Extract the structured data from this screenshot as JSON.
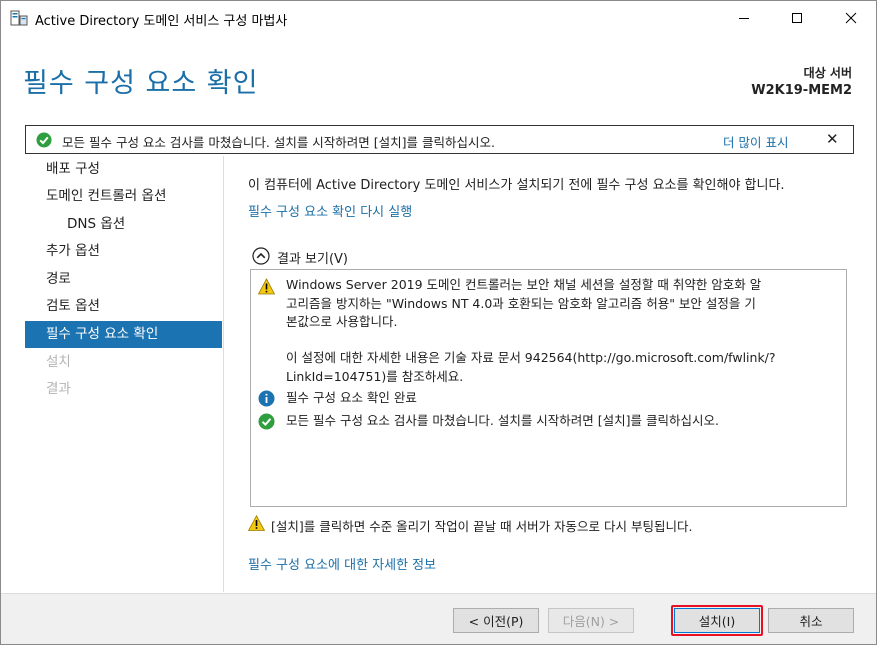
{
  "window": {
    "title": "Active Directory 도메인 서비스 구성 마법사"
  },
  "header": {
    "page_title": "필수 구성 요소 확인",
    "target_label": "대상 서버",
    "target_name": "W2K19-MEM2"
  },
  "notification": {
    "text": "모든 필수 구성 요소 검사를 마쳤습니다. 설치를 시작하려면 [설치]를 클릭하십시오.",
    "more_label": "더 많이 표시",
    "close_label": "✕"
  },
  "nav": {
    "items": [
      {
        "label": "배포 구성",
        "state": "normal"
      },
      {
        "label": "도메인 컨트롤러 옵션",
        "state": "normal"
      },
      {
        "label": "DNS 옵션",
        "state": "normal"
      },
      {
        "label": "추가 옵션",
        "state": "normal"
      },
      {
        "label": "경로",
        "state": "normal"
      },
      {
        "label": "검토 옵션",
        "state": "normal"
      },
      {
        "label": "필수 구성 요소 확인",
        "state": "active"
      },
      {
        "label": "설치",
        "state": "disabled"
      },
      {
        "label": "결과",
        "state": "disabled"
      }
    ]
  },
  "content": {
    "intro": "이 컴퓨터에 Active Directory 도메인 서비스가 설치되기 전에 필수 구성 요소를 확인해야 합니다.",
    "rerun_link": "필수 구성 요소 확인 다시 실행",
    "results_label": "결과 보기(V)",
    "results": {
      "warning_lines": [
        "Windows Server 2019 도메인 컨트롤러는 보안 채널 세션을 설정할 때 취약한 암호화 알",
        "고리즘을 방지하는 \"Windows NT 4.0과 호환되는 암호화 알고리즘 허용\" 보안 설정을 기",
        "본값으로 사용합니다."
      ],
      "detail_lines": [
        "이 설정에 대한 자세한 내용은 기술 자료 문서 942564(http://go.microsoft.com/fwlink/?",
        "LinkId=104751)를 참조하세요."
      ],
      "info_line": "필수 구성 요소 확인 완료",
      "success_line": "모든 필수 구성 요소 검사를 마쳤습니다. 설치를 시작하려면 [설치]를 클릭하십시오."
    },
    "bottom_warning": "[설치]를 클릭하면 수준 올리기 작업이 끝날 때 서버가 자동으로 다시 부팅됩니다.",
    "more_info_link": "필수 구성 요소에 대한 자세한 정보"
  },
  "footer": {
    "prev_label": "< 이전(P)",
    "next_label": "다음(N) >",
    "install_label": "설치(I)",
    "cancel_label": "취소"
  },
  "colors": {
    "accent": "#1c73b2",
    "link": "#1b6fa8",
    "success": "#2e9e3e",
    "info": "#1c73b2",
    "warning": "#f2c811",
    "highlight": "#e81123"
  }
}
